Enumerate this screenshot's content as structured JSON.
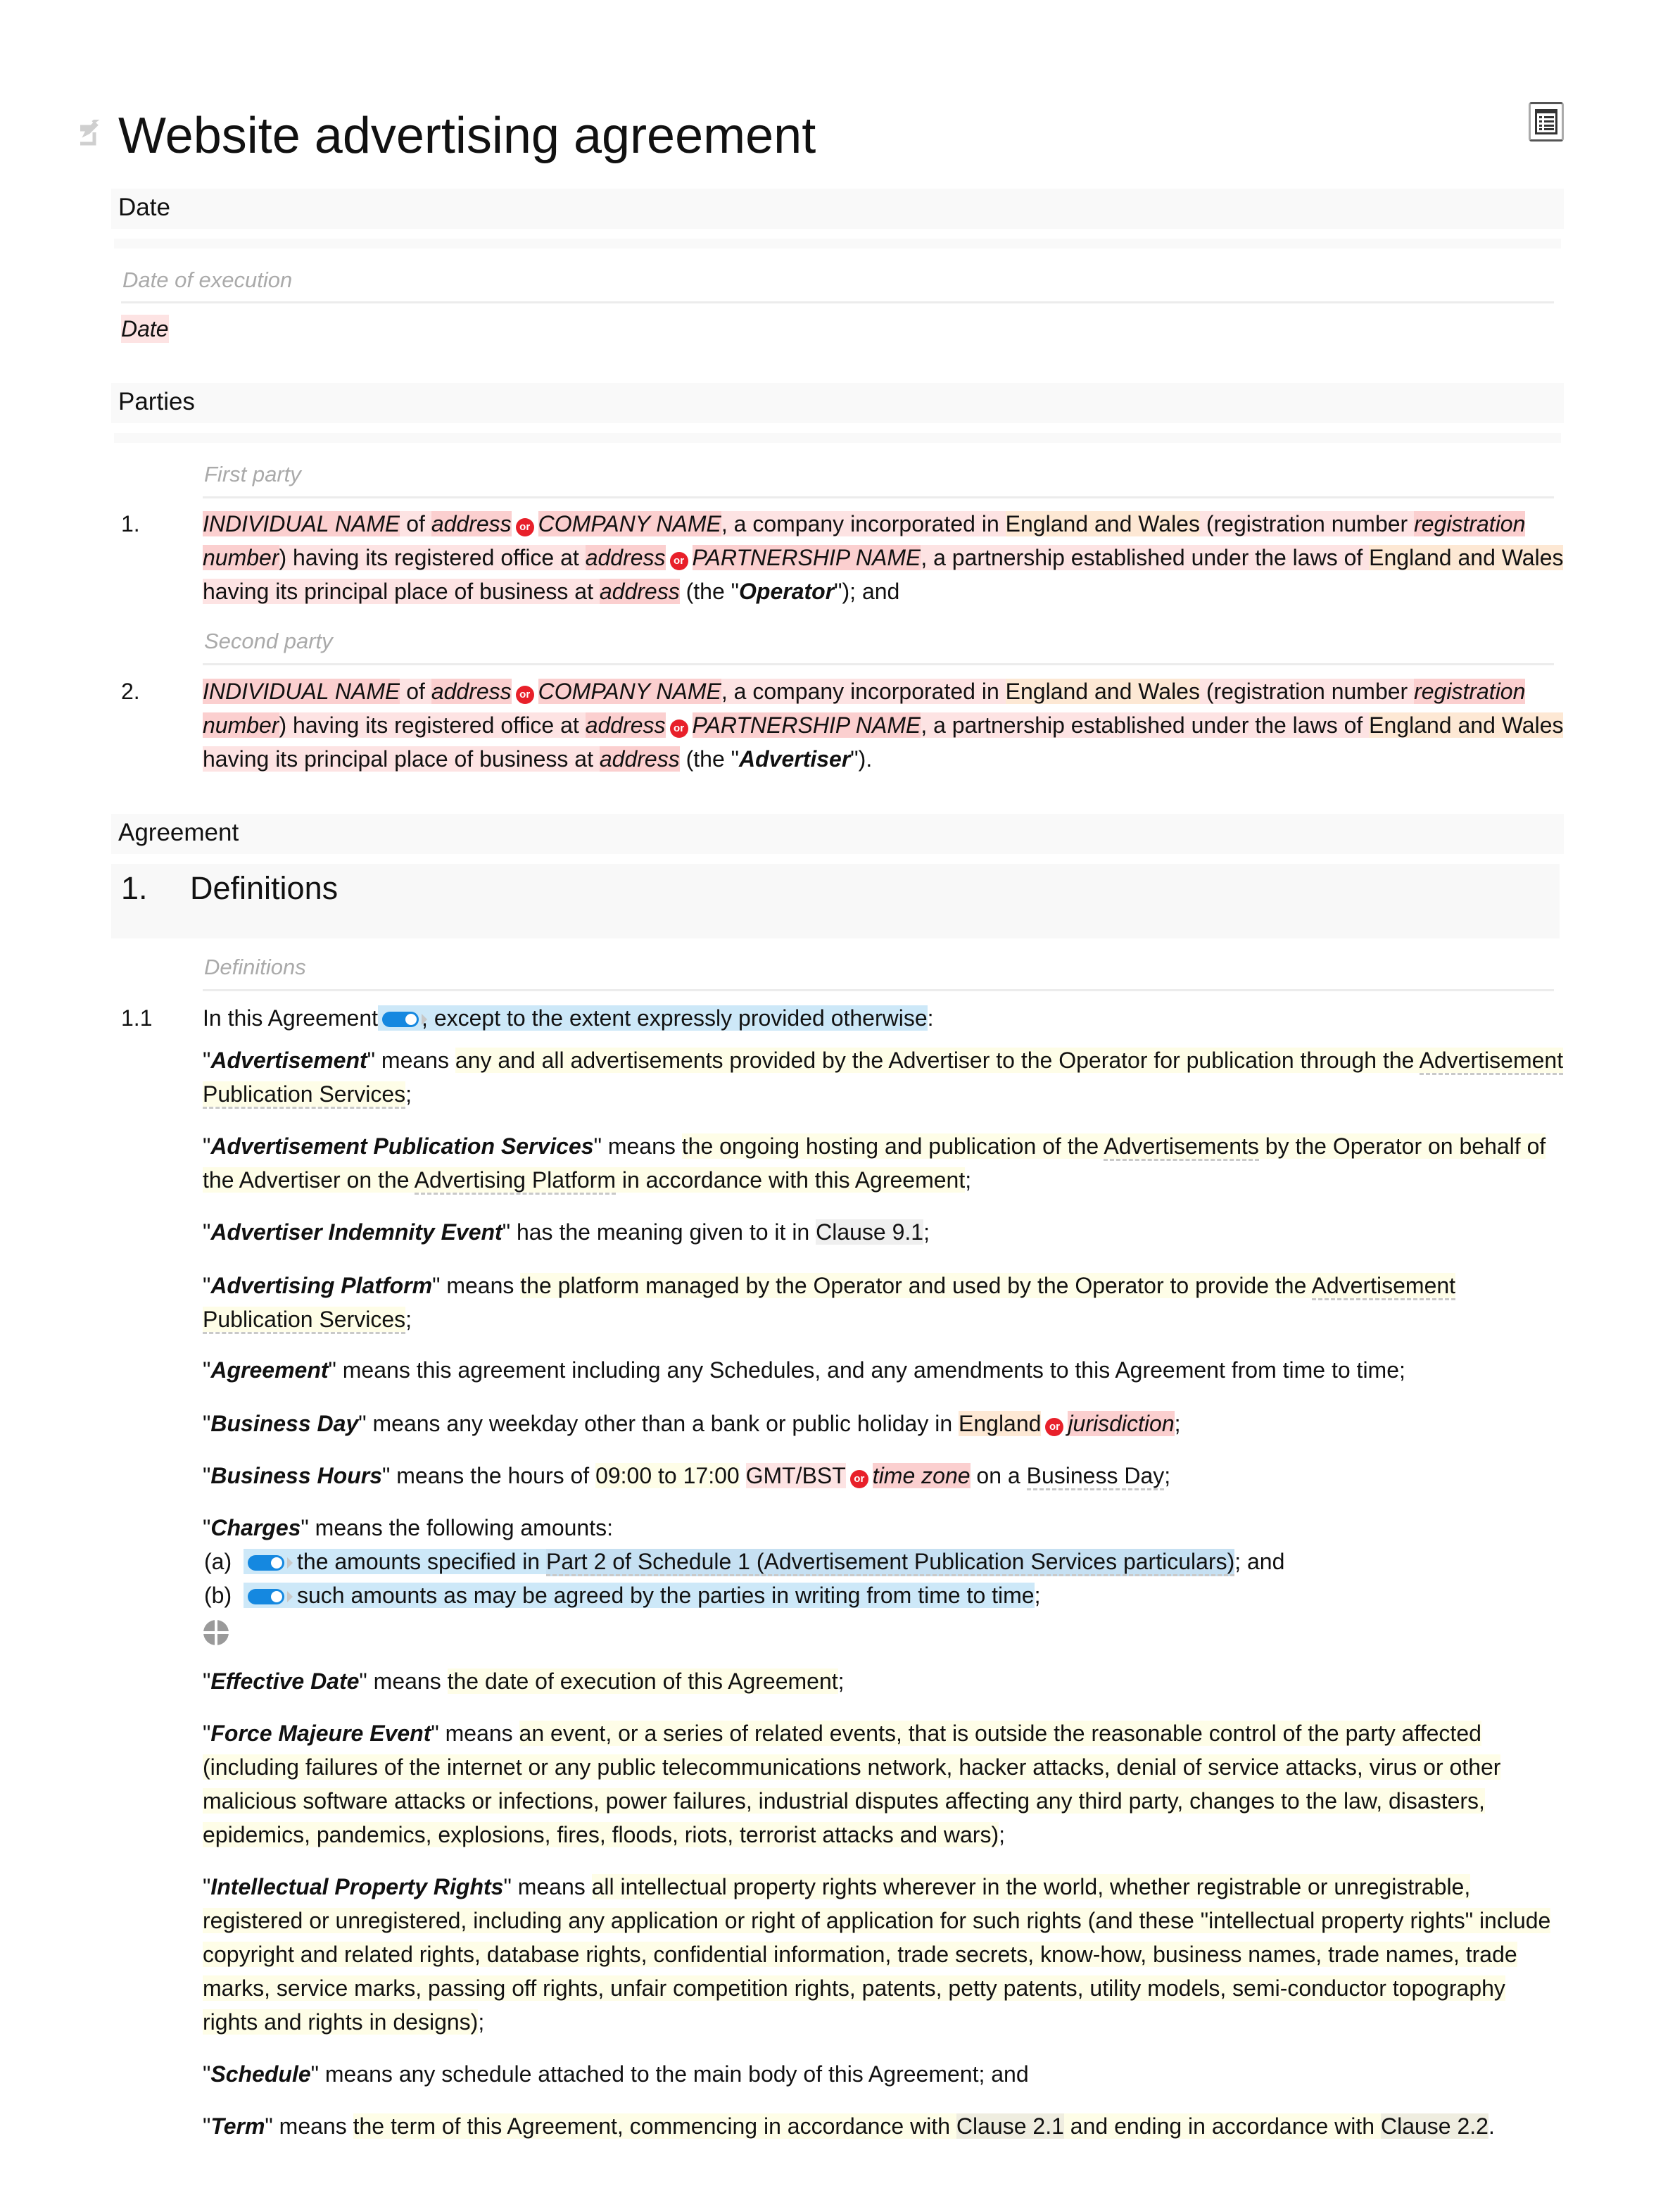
{
  "document": {
    "title": "Website advertising agreement",
    "edit_icon": "edit-icon",
    "toc_icon": "table-of-contents-icon"
  },
  "date_section": {
    "heading": "Date",
    "field_label": "Date of execution",
    "value": "Date"
  },
  "parties_section": {
    "heading": "Parties",
    "or_label": "or",
    "parties": [
      {
        "label": "First party",
        "number": "1.",
        "individual_name": "INDIVIDUAL NAME",
        "of": " of ",
        "address1": "address",
        "company_name": "COMPANY NAME",
        "company_text": ", a company incorporated in ",
        "jurisdiction1": "England and Wales",
        "reg_text": " (registration number ",
        "registration_number": "registration number",
        "office_text": ") having its registered office at ",
        "address2": "address",
        "partnership_name": "PARTNERSHIP NAME",
        "partnership_text": ", a partnership established under the laws of ",
        "jurisdiction2": "England and Wales",
        "business_text": " having its principal place of business at ",
        "address3": "address",
        "the_open": " (the \"",
        "role": "Operator",
        "the_close": "\"); and"
      },
      {
        "label": "Second party",
        "number": "2.",
        "individual_name": "INDIVIDUAL NAME",
        "of": " of ",
        "address1": "address",
        "company_name": "COMPANY NAME",
        "company_text": ", a company incorporated in ",
        "jurisdiction1": "England and Wales",
        "reg_text": " (registration number ",
        "registration_number": "registration number",
        "office_text": ") having its registered office at ",
        "address2": "address",
        "partnership_name": "PARTNERSHIP NAME",
        "partnership_text": ", a partnership established under the laws of ",
        "jurisdiction2": "England and Wales",
        "business_text": " having its principal place of business at ",
        "address3": "address",
        "the_open": " (the \"",
        "role": "Advertiser",
        "the_close": "\")."
      }
    ]
  },
  "agreement_section": {
    "heading": "Agreement",
    "clause_number": "1.",
    "clause_title": "Definitions",
    "field_label": "Definitions",
    "sub_number": "1.1",
    "intro_start": "In this Agreement",
    "intro_optional": ", except to the extent expressly provided otherwise",
    "intro_end": ":",
    "definitions": {
      "advertisement": {
        "term": "Advertisement",
        "means": "\" means ",
        "text": "any and all advertisements provided by the Advertiser to the Operator for publication through the ",
        "link": "Advertisement Publication Services",
        "end": ";"
      },
      "aps": {
        "term": "Advertisement Publication Services",
        "means": "\" means ",
        "text1": "the ongoing hosting and publication of the ",
        "link1": "Advertisements",
        "text2": " by the Operator on behalf of the Advertiser on the ",
        "link2": "Advertising Platform",
        "text3": " in accordance with this Agreement",
        "end": ";"
      },
      "aie": {
        "term": "Advertiser Indemnity Event",
        "means": "\" has the meaning given to it in ",
        "ref": "Clause 9.1",
        "end": ";"
      },
      "platform": {
        "term": "Advertising Platform",
        "means": "\" means ",
        "text": "the platform managed by the Operator and used by the Operator to provide the ",
        "link": "Advertisement Publication Services",
        "end": ";"
      },
      "agreement": {
        "term": "Agreement",
        "means": "\" means this agreement including any Schedules, and any amendments to this Agreement from time to time;"
      },
      "business_day": {
        "term": "Business Day",
        "means": "\" means any weekday other than a bank or public holiday in ",
        "place": "England",
        "alt": "jurisdiction",
        "end": ";"
      },
      "business_hours": {
        "term": "Business Hours",
        "means": "\" means the hours of ",
        "hours": "09:00 to 17:00",
        "tz": "GMT/BST",
        "alt": "time zone",
        "text": " on a ",
        "link": "Business Day",
        "end": ";"
      },
      "charges": {
        "term": "Charges",
        "means": "\" means the following amounts:",
        "items": [
          {
            "label": "(a)",
            "text": "the amounts specified in ",
            "ref": "Part 2 of Schedule 1 (Advertisement Publication Services particulars)",
            "end": "; and"
          },
          {
            "label": "(b)",
            "text": "such amounts as may be agreed by the parties in writing from time to time",
            "end": ";"
          }
        ],
        "add_icon": "add-item-icon"
      },
      "effective_date": {
        "term": "Effective Date",
        "means": "\" means ",
        "text": "the date of execution of this Agreement",
        "end": ";"
      },
      "force_majeure": {
        "term": "Force Majeure Event",
        "means": "\" means ",
        "text": "an event, or a series of related events, that is outside the reasonable control of the party affected (including failures of the internet or any public telecommunications network, hacker attacks, denial of service attacks, virus or other malicious software attacks or infections, power failures, industrial disputes affecting any third party, changes to the law, disasters, epidemics, pandemics, explosions, fires, floods, riots, terrorist attacks and wars)",
        "end": ";"
      },
      "ipr": {
        "term": "Intellectual Property Rights",
        "means": "\" means ",
        "text": "all intellectual property rights wherever in the world, whether registrable or unregistrable, registered or unregistered, including any application or right of application for such rights (and these \"intellectual property rights\" include copyright and related rights, database rights, confidential information, trade secrets, know-how, business names, trade names, trade marks, service marks, passing off rights, unfair competition rights, patents, petty patents, utility models, semi-conductor topography rights and rights in designs)",
        "end": ";"
      },
      "schedule": {
        "term": "Schedule",
        "means": "\" means any schedule attached to the main body of this Agreement; and"
      },
      "term": {
        "term": "Term",
        "means": "\" means ",
        "text1": "the term of this Agreement, commencing in accordance with ",
        "ref1": "Clause 2.1",
        "text2": " and ending in accordance with ",
        "ref2": "Clause 2.2",
        "end": "."
      }
    }
  },
  "colors": {
    "placeholder_red": "#fbcfcf",
    "option_pink": "#fde3e3",
    "jurisdiction_orange": "#fde8d4",
    "editable_yellow": "#fefde7",
    "optional_blue": "#cde8f8",
    "or_badge": "#e8202a",
    "toggle_blue": "#1588e0"
  }
}
